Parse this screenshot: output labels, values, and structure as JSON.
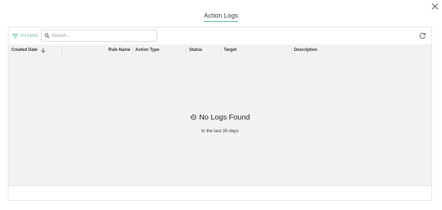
{
  "dialog": {
    "title": "Action Logs",
    "close_icon": "close-icon"
  },
  "toolbar": {
    "filters_label": "FILTERS",
    "search_placeholder": "Search...",
    "accent_color": "#4caf7d"
  },
  "table": {
    "columns": [
      {
        "label": "Created Date",
        "sort": "descending"
      },
      {
        "label": "Rule Name"
      },
      {
        "label": "Action Type"
      },
      {
        "label": "Status"
      },
      {
        "label": "Target"
      },
      {
        "label": "Description"
      }
    ]
  },
  "empty_state": {
    "title": "No Logs Found",
    "subtitle": "In the last 30 days",
    "icon": "history-icon"
  }
}
